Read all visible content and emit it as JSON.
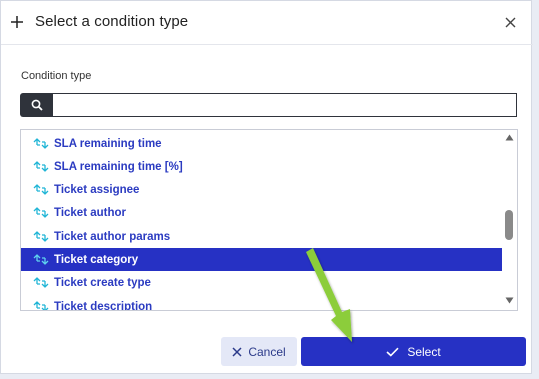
{
  "dialog": {
    "title": "Select a condition type",
    "field_label": "Condition type",
    "search": {
      "value": "",
      "placeholder": ""
    },
    "items": [
      {
        "label": "SLA remaining time",
        "selected": false
      },
      {
        "label": "SLA remaining time [%]",
        "selected": false
      },
      {
        "label": "Ticket assignee",
        "selected": false
      },
      {
        "label": "Ticket author",
        "selected": false
      },
      {
        "label": "Ticket author params",
        "selected": false
      },
      {
        "label": "Ticket category",
        "selected": true
      },
      {
        "label": "Ticket create type",
        "selected": false
      },
      {
        "label": "Ticket description",
        "selected": false
      }
    ],
    "cancel_label": "Cancel",
    "select_label": "Select"
  },
  "icons": {
    "header": "plus-icon",
    "close": "close-icon",
    "search": "search-icon",
    "item": "swap-icon",
    "cancel": "x-icon",
    "select": "check-icon"
  },
  "colors": {
    "accent": "#2631c4",
    "item_text": "#2b3bc1",
    "item_icon": "#1fb5d6",
    "cancel_bg": "#e4e8f7",
    "search_btn_bg": "#2f333b",
    "annotation_arrow": "#8ccd3b"
  }
}
